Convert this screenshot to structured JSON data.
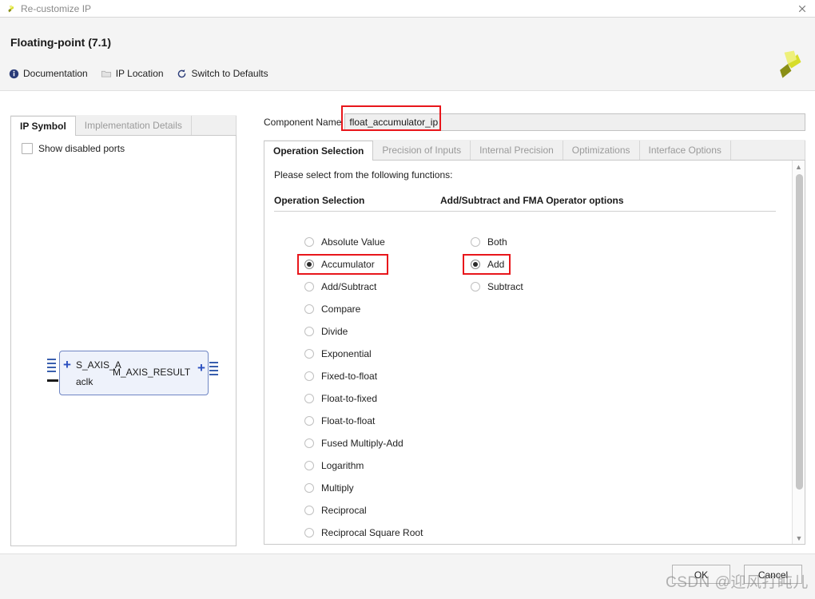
{
  "window": {
    "title": "Re-customize IP",
    "close_icon": "close-icon",
    "app_logo_icon": "xilinx-logo-icon"
  },
  "header": {
    "title": "Floating-point (7.1)",
    "logo_icon": "xilinx-logo-icon",
    "toolbar": [
      {
        "label": "Documentation",
        "icon": "info-icon"
      },
      {
        "label": "IP Location",
        "icon": "folder-icon"
      },
      {
        "label": "Switch to Defaults",
        "icon": "refresh-icon"
      }
    ]
  },
  "left_panel": {
    "tabs": [
      {
        "label": "IP Symbol",
        "active": true
      },
      {
        "label": "Implementation Details",
        "active": false
      }
    ],
    "show_disabled_ports": {
      "label": "Show disabled ports",
      "checked": false
    },
    "symbol": {
      "port_in": "S_AXIS_A",
      "port_out": "M_AXIS_RESULT",
      "clock": "aclk",
      "expand_icon": "plus-icon",
      "bus_icon": "bus-connector-icon"
    }
  },
  "right_panel": {
    "component_name_label": "Component Name",
    "component_name_value": "float_accumulator_ip",
    "tabs": [
      {
        "label": "Operation Selection",
        "active": true
      },
      {
        "label": "Precision of Inputs",
        "active": false
      },
      {
        "label": "Internal Precision",
        "active": false
      },
      {
        "label": "Optimizations",
        "active": false
      },
      {
        "label": "Interface Options",
        "active": false
      }
    ],
    "prompt": "Please select from the following functions:",
    "operation_group": {
      "header": "Operation Selection",
      "options": [
        {
          "label": "Absolute Value",
          "checked": false,
          "highlighted": false
        },
        {
          "label": "Accumulator",
          "checked": true,
          "highlighted": true
        },
        {
          "label": "Add/Subtract",
          "checked": false,
          "highlighted": false
        },
        {
          "label": "Compare",
          "checked": false,
          "highlighted": false
        },
        {
          "label": "Divide",
          "checked": false,
          "highlighted": false
        },
        {
          "label": "Exponential",
          "checked": false,
          "highlighted": false
        },
        {
          "label": "Fixed-to-float",
          "checked": false,
          "highlighted": false
        },
        {
          "label": "Float-to-fixed",
          "checked": false,
          "highlighted": false
        },
        {
          "label": "Float-to-float",
          "checked": false,
          "highlighted": false
        },
        {
          "label": "Fused Multiply-Add",
          "checked": false,
          "highlighted": false
        },
        {
          "label": "Logarithm",
          "checked": false,
          "highlighted": false
        },
        {
          "label": "Multiply",
          "checked": false,
          "highlighted": false
        },
        {
          "label": "Reciprocal",
          "checked": false,
          "highlighted": false
        },
        {
          "label": "Reciprocal Square Root",
          "checked": false,
          "highlighted": false
        }
      ]
    },
    "fma_group": {
      "header": "Add/Subtract and FMA Operator options",
      "options": [
        {
          "label": "Both",
          "checked": false,
          "highlighted": false
        },
        {
          "label": "Add",
          "checked": true,
          "highlighted": true
        },
        {
          "label": "Subtract",
          "checked": false,
          "highlighted": false
        }
      ]
    },
    "scrollbar": {
      "up_icon": "chevron-up-icon",
      "down_icon": "chevron-down-icon"
    }
  },
  "footer": {
    "ok_label": "OK",
    "cancel_label": "Cancel"
  },
  "watermark": "CSDN @迎风打盹儿",
  "colors": {
    "highlight_red": "#e8161b",
    "accent_blue": "#2a4fc0",
    "logo_green": "#c8d41e",
    "header_bg": "#f4f4f4"
  }
}
